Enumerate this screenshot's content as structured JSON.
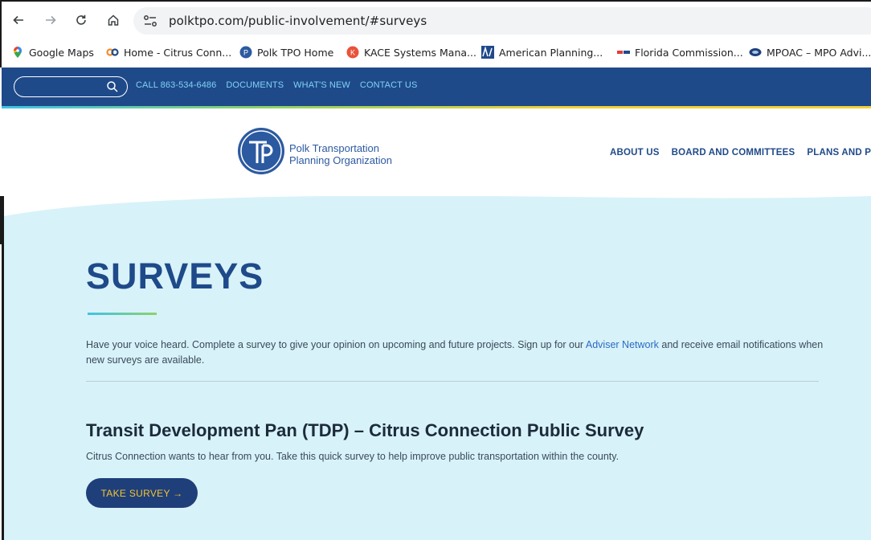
{
  "browser": {
    "url": "polktpo.com/public-involvement/#surveys",
    "bookmarks": [
      {
        "label": "Google Maps",
        "icon": "google-maps-icon"
      },
      {
        "label": "Home - Citrus Conn...",
        "icon": "citrus-connection-icon"
      },
      {
        "label": "Polk TPO Home",
        "icon": "polk-tpo-icon"
      },
      {
        "label": "KACE Systems Mana...",
        "icon": "kace-icon"
      },
      {
        "label": "American Planning...",
        "icon": "apa-icon"
      },
      {
        "label": "Florida Commission...",
        "icon": "florida-commission-icon"
      },
      {
        "label": "MPOAC – MPO Advi...",
        "icon": "mpoac-icon"
      }
    ]
  },
  "utility_bar": {
    "links": [
      "CALL 863-534-6486",
      "DOCUMENTS",
      "WHAT'S NEW",
      "CONTACT US"
    ]
  },
  "header": {
    "logo_line1": "Polk Transportation",
    "logo_line2": "Planning Organization",
    "nav": [
      "ABOUT US",
      "BOARD AND COMMITTEES",
      "PLANS AND PRO"
    ]
  },
  "main": {
    "title": "SURVEYS",
    "intro_before": "Have your voice heard. Complete a survey to give your opinion on upcoming and future projects. Sign up for our ",
    "intro_link": "Adviser Network",
    "intro_after": " and receive email notifications when new surveys are available.",
    "survey": {
      "title": "Transit Development Pan (TDP) – Citrus Connection Public Survey",
      "description": "Citrus Connection wants to hear from you. Take this quick survey to help improve public transportation within the county.",
      "button_label": "TAKE SURVEY →"
    }
  },
  "colors": {
    "brand_navy": "#1f4a8a",
    "content_bg": "#d8f2f9",
    "button_bg": "#1f3f7a",
    "button_text": "#f4c430",
    "link": "#2c6bc4"
  }
}
